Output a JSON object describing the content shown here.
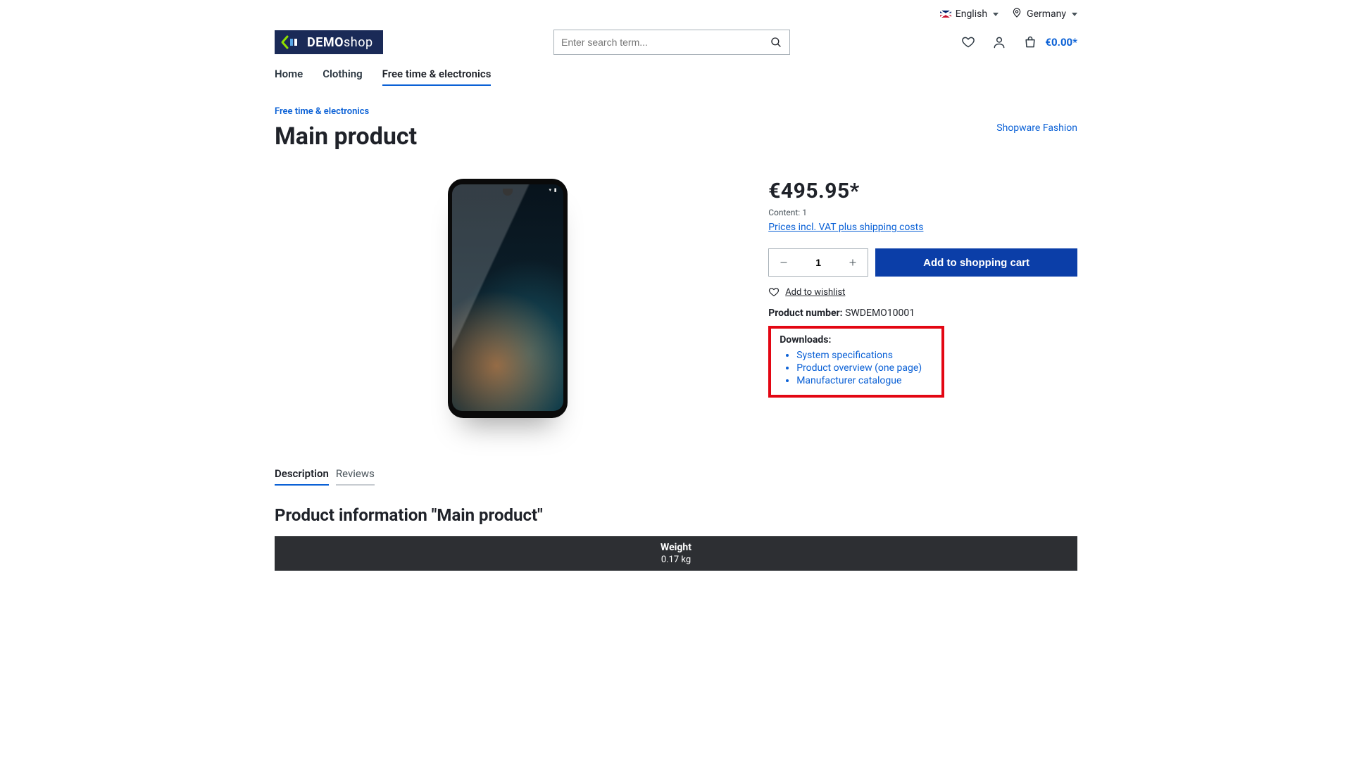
{
  "topbar": {
    "language_label": "English",
    "country_label": "Germany"
  },
  "logo": {
    "brand_a": "DEMO",
    "brand_b": "shop"
  },
  "search": {
    "placeholder": "Enter search term..."
  },
  "header": {
    "cart_total": "€0.00*"
  },
  "nav": {
    "items": [
      {
        "label": "Home"
      },
      {
        "label": "Clothing"
      },
      {
        "label": "Free time & electronics"
      }
    ]
  },
  "breadcrumb": {
    "label": "Free time & electronics"
  },
  "title": "Main product",
  "brand_link": "Shopware Fashion",
  "buy": {
    "price": "€495.95*",
    "content_line": "Content: 1",
    "tax_link": "Prices incl. VAT plus shipping costs",
    "qty": "1",
    "add_label": "Add to shopping cart",
    "wishlist_label": "Add to wishlist",
    "sku_label": "Product number:",
    "sku_value": "SWDEMO10001"
  },
  "downloads": {
    "title": "Downloads:",
    "items": [
      "System specifications",
      "Product overview (one page)",
      "Manufacturer catalogue"
    ]
  },
  "tabs": {
    "items": [
      "Description",
      "Reviews"
    ]
  },
  "info_heading": "Product information \"Main product\"",
  "spec": {
    "key": "Weight",
    "value": "0.17 kg"
  }
}
